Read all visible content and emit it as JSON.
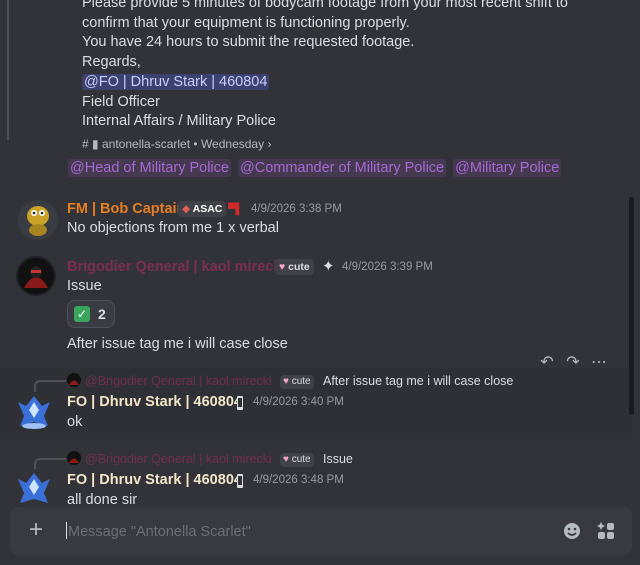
{
  "quoted_message": {
    "lines": [
      "Please provide 5 minutes of bodycam footage from your most recent shift to",
      "confirm that your equipment is functioning properly.",
      "You have 24 hours to submit the requested footage.",
      "Regards,"
    ],
    "mention": "@FO | Dhruv Stark | 460804",
    "signature": [
      "Field Officer",
      "Internal Affairs / Military Police"
    ],
    "source_channel": "antonella-scarlet",
    "source_day": "Wednesday"
  },
  "role_mentions": [
    "@Head of Military Police",
    "@Commander of Military Police",
    "@Military Police"
  ],
  "messages": [
    {
      "author": "FM | Bob Captain",
      "author_color": "#e67e22",
      "tag": "ASAC",
      "timestamp": "4/9/2026 3:38 PM",
      "text": "No objections from me 1 x verbal"
    },
    {
      "author": "Brigodier Qeneral | kaol mirecki",
      "author_color": "#7b2e50",
      "tag": "cute",
      "timestamp": "4/9/2026 3:39 PM",
      "text": "Issue",
      "reaction": {
        "emoji": "✅",
        "count": "2"
      },
      "followup": "After issue tag me i will case close"
    },
    {
      "author": "FO | Dhruv Stark | 460804",
      "author_color": "#f1e6c8",
      "timestamp": "4/9/2026 3:40 PM",
      "text": "ok",
      "reply_to": {
        "author": "@Brigodier Qeneral | kaol mirecki",
        "tag": "cute",
        "text": "After issue tag me i will case close"
      }
    },
    {
      "author": "FO | Dhruv Stark | 460804",
      "author_color": "#f1e6c8",
      "timestamp": "4/9/2026 3:48 PM",
      "text": "all done sir",
      "reply_to": {
        "author": "@Brigodier Qeneral | kaol mirecki",
        "tag": "cute",
        "text": "Issue"
      }
    }
  ],
  "composer": {
    "placeholder": "Message \"Antonella Scarlet\""
  },
  "icons": {
    "toolbar": [
      "reply-icon",
      "forward-icon",
      "more-icon"
    ],
    "composer": [
      "plus-icon",
      "emoji-icon",
      "apps-icon"
    ]
  }
}
